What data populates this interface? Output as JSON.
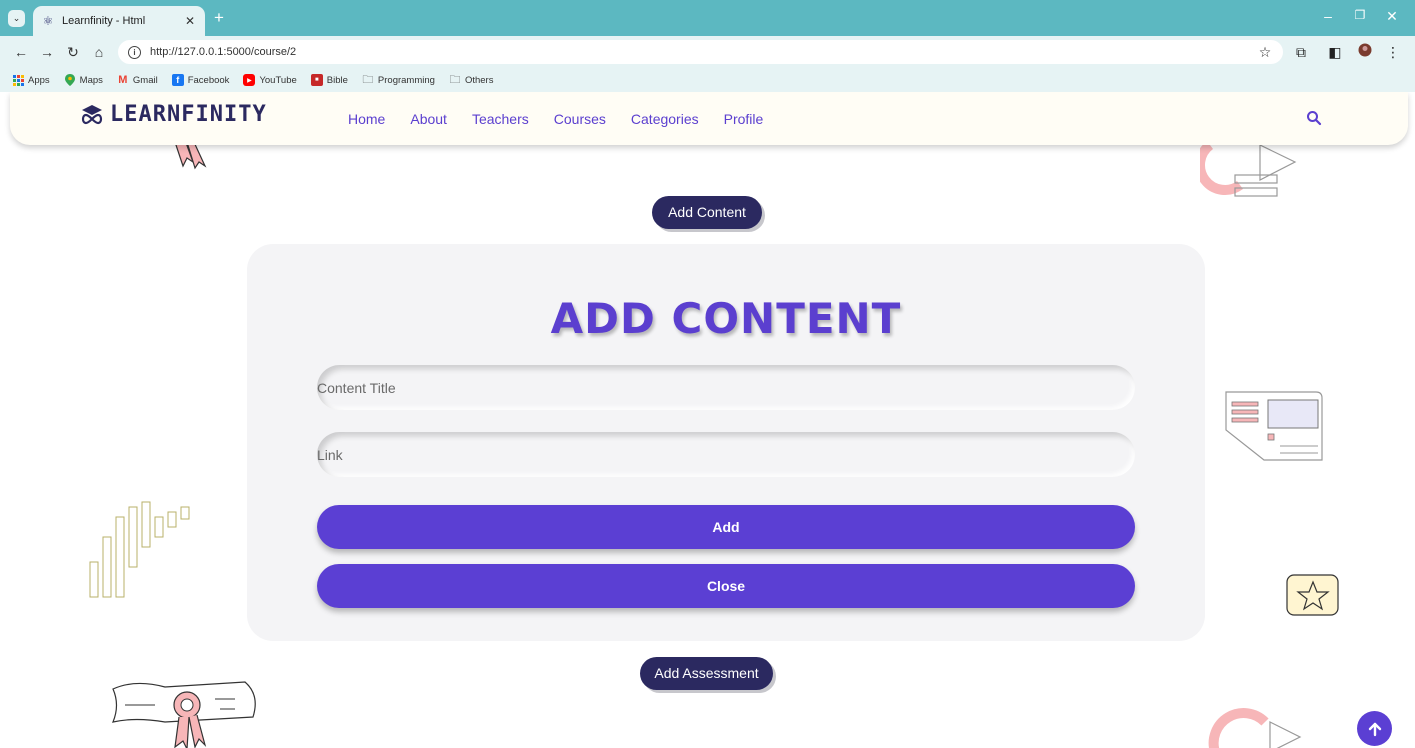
{
  "browser": {
    "tab_title": "Learnfinity - Html",
    "url": "http://127.0.0.1:5000/course/2",
    "bookmarks": [
      {
        "label": "Apps",
        "icon": "apps-grid-icon"
      },
      {
        "label": "Maps",
        "icon": "maps-pin-icon"
      },
      {
        "label": "Gmail",
        "icon": "gmail-icon"
      },
      {
        "label": "Facebook",
        "icon": "facebook-icon"
      },
      {
        "label": "YouTube",
        "icon": "youtube-icon"
      },
      {
        "label": "Bible",
        "icon": "bible-icon"
      },
      {
        "label": "Programming",
        "icon": "folder-icon"
      },
      {
        "label": "Others",
        "icon": "folder-icon"
      }
    ]
  },
  "site": {
    "logo_text": "LEARNFINITY",
    "nav": [
      "Home",
      "About",
      "Teachers",
      "Courses",
      "Categories",
      "Profile"
    ]
  },
  "main": {
    "add_content_pill": "Add Content",
    "add_assessment_pill": "Add Assessment",
    "form": {
      "heading": "ADD CONTENT",
      "title_placeholder": "Content Title",
      "link_placeholder": "Link",
      "add_label": "Add",
      "close_label": "Close"
    }
  },
  "colors": {
    "accent": "#5b3fd3",
    "navy": "#2b2960",
    "chrome": "#5cb8c1",
    "card": "#f4f4f6"
  }
}
